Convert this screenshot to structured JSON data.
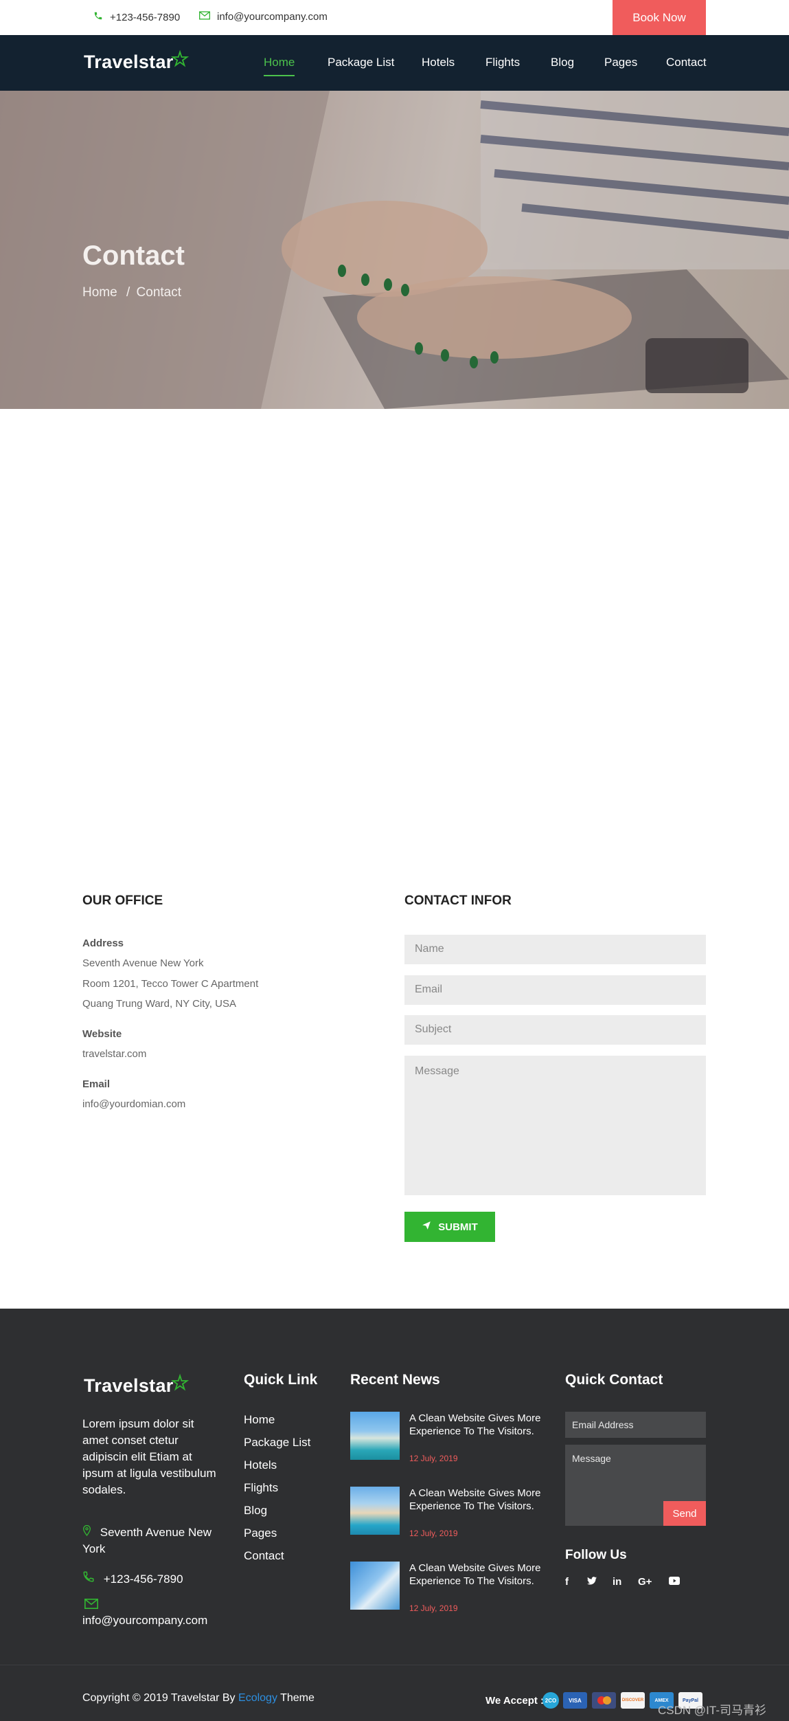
{
  "topbar": {
    "phone": "+123-456-7890",
    "email": "info@yourcompany.com",
    "book_label": "Book Now"
  },
  "brand": {
    "name": "Travelstar",
    "accent_color": "#32b432",
    "cta_color": "#f05c5c",
    "nav_bg": "#132230",
    "footer_bg": "#2e2f31"
  },
  "nav": {
    "items": [
      {
        "label": "Home",
        "active": true
      },
      {
        "label": "Package List"
      },
      {
        "label": "Hotels"
      },
      {
        "label": "Flights"
      },
      {
        "label": "Blog"
      },
      {
        "label": "Pages"
      },
      {
        "label": "Contact"
      }
    ]
  },
  "hero": {
    "title": "Contact",
    "breadcrumb_home": "Home",
    "breadcrumb_sep": "/",
    "breadcrumb_current": "Contact"
  },
  "office": {
    "title": "OUR OFFICE",
    "address_label": "Address",
    "address_lines": [
      "Seventh Avenue New York",
      "Room 1201, Tecco Tower C Apartment",
      "Quang Trung Ward, NY City, USA"
    ],
    "website_label": "Website",
    "website": "travelstar.com",
    "email_label": "Email",
    "email": "info@yourdomian.com"
  },
  "contact_form": {
    "title": "CONTACT INFOR",
    "name_placeholder": "Name",
    "email_placeholder": "Email",
    "subject_placeholder": "Subject",
    "message_placeholder": "Message",
    "submit_label": "SUBMIT"
  },
  "footer": {
    "description": "Lorem ipsum dolor sit amet conset ctetur adipiscin elit Etiam at ipsum at ligula vestibulum sodales.",
    "address": "Seventh Avenue New York",
    "phone": "+123-456-7890",
    "email": "info@yourcompany.com",
    "quick_link_title": "Quick Link",
    "quick_links": [
      "Home",
      "Package List",
      "Hotels",
      "Flights",
      "Blog",
      "Pages",
      "Contact"
    ],
    "recent_news_title": "Recent News",
    "news": [
      {
        "title": "A Clean Website Gives More Experience To The Visitors.",
        "date": "12 July, 2019"
      },
      {
        "title": "A Clean Website Gives More Experience To The Visitors.",
        "date": "12 July, 2019"
      },
      {
        "title": "A Clean Website Gives More Experience To The Visitors.",
        "date": "12 July, 2019"
      }
    ],
    "quick_contact_title": "Quick Contact",
    "qc_email_placeholder": "Email Address",
    "qc_message_placeholder": "Message",
    "qc_send_label": "Send",
    "follow_title": "Follow Us",
    "social_icons": [
      "facebook-icon",
      "twitter-icon",
      "linkedin-icon",
      "google-plus-icon",
      "youtube-icon"
    ],
    "copyright_prefix": "Copyright © 2019 Travelstar By",
    "copyright_link": "Ecology",
    "copyright_suffix": "Theme",
    "we_accept": "We Accept :",
    "payment_cards": [
      "2CO",
      "VISA",
      "MasterCard",
      "DISCOVER",
      "AMEX",
      "PayPal"
    ],
    "watermark": "CSDN @IT-司马青衫"
  }
}
